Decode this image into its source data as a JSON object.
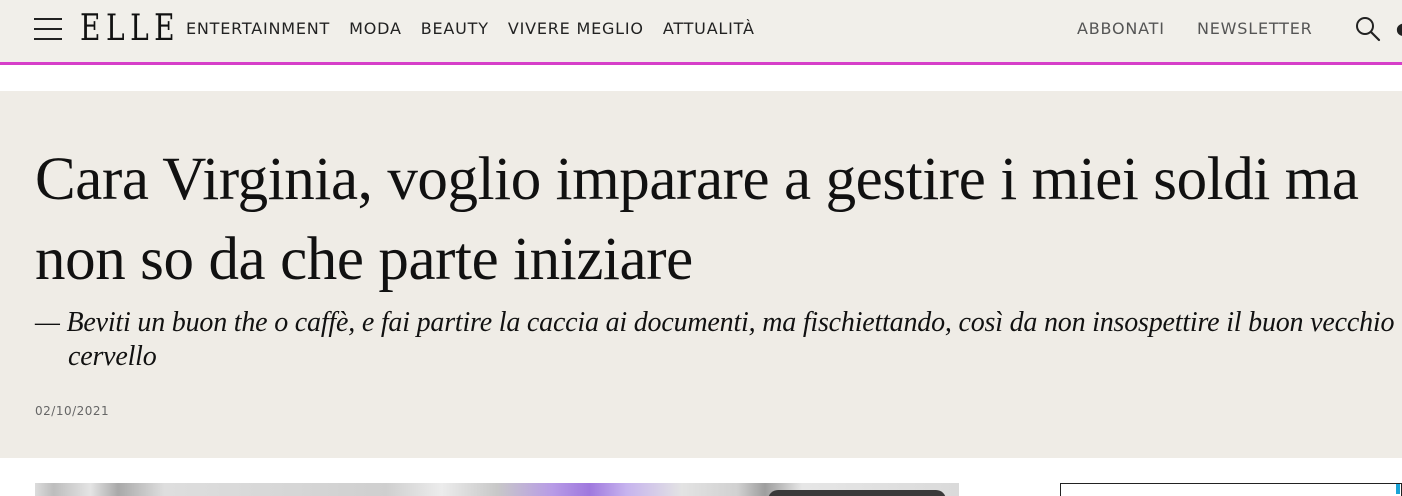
{
  "brand": {
    "logo_text": "ELLE",
    "accent_color": "#d63fc9",
    "hero_background": "#efece6"
  },
  "nav": {
    "items": [
      {
        "label": "ENTERTAINMENT"
      },
      {
        "label": "MODA"
      },
      {
        "label": "BEAUTY"
      },
      {
        "label": "VIVERE MEGLIO"
      },
      {
        "label": "ATTUALITÀ"
      }
    ],
    "subscribe_label": "ABBONATI",
    "newsletter_label": "NEWSLETTER",
    "icons": [
      "menu-icon",
      "search-icon"
    ]
  },
  "article": {
    "headline": "Cara Virginia, voglio imparare a gestire i miei soldi ma non so da che parte iniziare",
    "subheadline": "— Beviti un buon the o caffè, e fai partire la caccia ai documenti, ma fischiettando, così da non insospettire il buon vecchio cervello",
    "date": "02/10/2021"
  }
}
